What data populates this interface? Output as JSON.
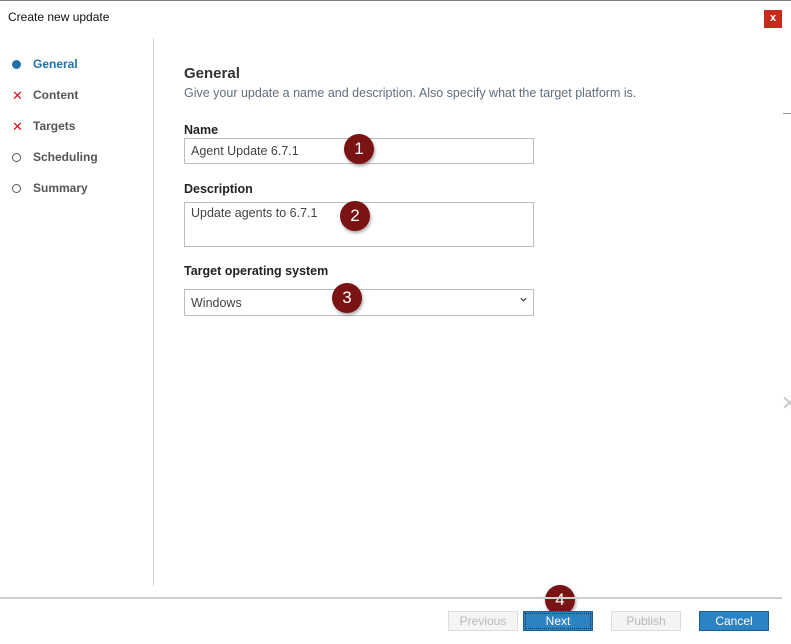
{
  "window": {
    "title": "Create new update",
    "close_label": "x"
  },
  "steps": [
    {
      "label": "General",
      "status": "current",
      "icon": "filled-dot-icon"
    },
    {
      "label": "Content",
      "status": "error",
      "icon": "x-icon"
    },
    {
      "label": "Targets",
      "status": "error",
      "icon": "x-icon"
    },
    {
      "label": "Scheduling",
      "status": "pending",
      "icon": "empty-circle-icon"
    },
    {
      "label": "Summary",
      "status": "pending",
      "icon": "empty-circle-icon"
    }
  ],
  "general": {
    "title": "General",
    "subtitle": "Give your update a name and description. Also specify what the target platform is.",
    "name_label": "Name",
    "name_value": "Agent Update 6.7.1",
    "description_label": "Description",
    "description_value": "Update agents to 6.7.1",
    "os_label": "Target operating system",
    "os_value": "Windows"
  },
  "badges": [
    "1",
    "2",
    "3",
    "4"
  ],
  "footer": {
    "previous_label": "Previous",
    "next_label": "Next",
    "publish_label": "Publish",
    "cancel_label": "Cancel"
  },
  "colors": {
    "accent": "#1e72a8",
    "error": "#d8141f",
    "primary_button": "#2b83c4",
    "badge": "#7a1314",
    "close_button": "#c42b1c"
  }
}
